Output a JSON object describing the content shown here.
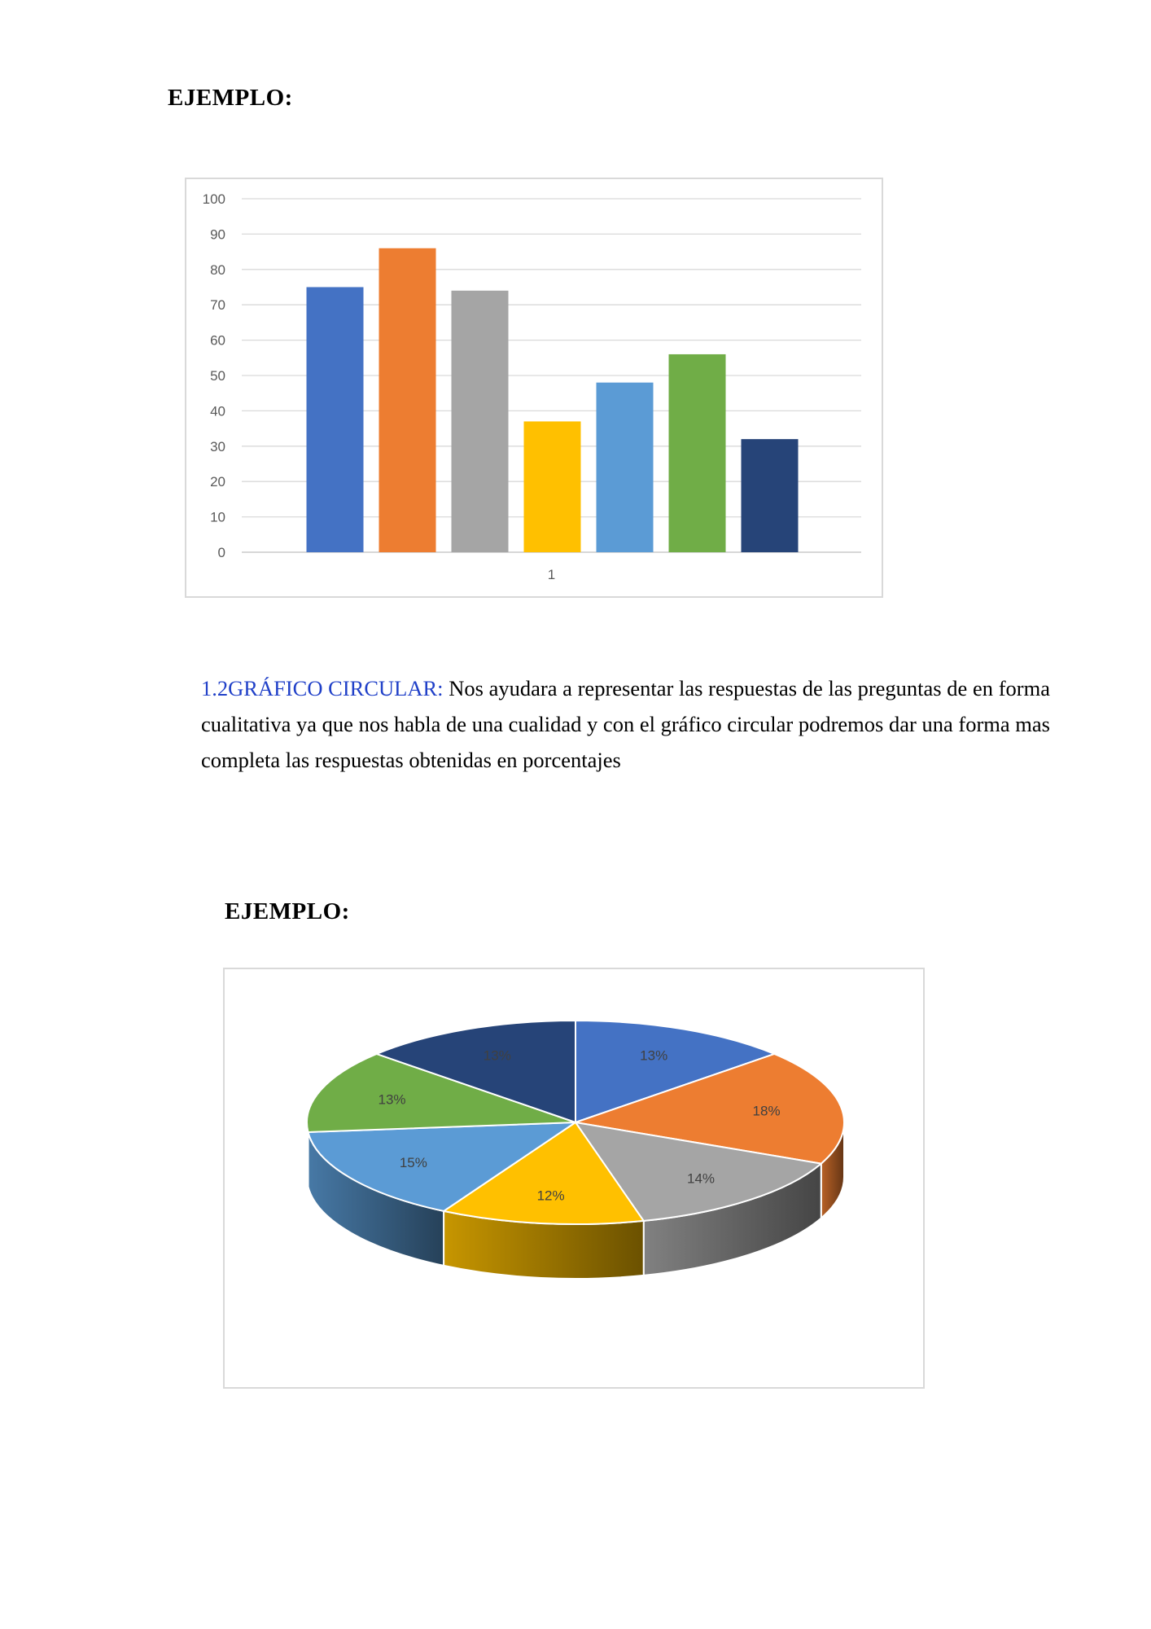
{
  "headings": {
    "first": "EJEMPLO:",
    "second": "EJEMPLO:"
  },
  "section": {
    "lead": "1.2GRÁFICO CIRCULAR:",
    "body": " Nos ayudara a representar  las respuestas  de las preguntas de  en forma cualitativa ya que nos habla de una cualidad y con el gráfico circular podremos dar una forma mas completa las respuestas obtenidas en porcentajes"
  },
  "chart_data": [
    {
      "type": "bar",
      "categories": [
        "1"
      ],
      "series": [
        {
          "values": [
            75
          ],
          "color": "#4472C4"
        },
        {
          "values": [
            86
          ],
          "color": "#ED7D31"
        },
        {
          "values": [
            74
          ],
          "color": "#A5A5A5"
        },
        {
          "values": [
            37
          ],
          "color": "#FFC000"
        },
        {
          "values": [
            48
          ],
          "color": "#5B9BD5"
        },
        {
          "values": [
            56
          ],
          "color": "#70AD47"
        },
        {
          "values": [
            32
          ],
          "color": "#264478"
        }
      ],
      "ylim": [
        0,
        100
      ],
      "yticks": [
        0,
        10,
        20,
        30,
        40,
        50,
        60,
        70,
        80,
        90,
        100
      ],
      "grid": true,
      "title": "",
      "xlabel": "",
      "ylabel": ""
    },
    {
      "type": "pie",
      "style": "3d",
      "slices": [
        {
          "label": "13%",
          "value": 13,
          "color": "#4472C4"
        },
        {
          "label": "18%",
          "value": 18,
          "color": "#ED7D31"
        },
        {
          "label": "14%",
          "value": 14,
          "color": "#A5A5A5"
        },
        {
          "label": "12%",
          "value": 12,
          "color": "#FFC000"
        },
        {
          "label": "15%",
          "value": 15,
          "color": "#5B9BD5"
        },
        {
          "label": "13%",
          "value": 13,
          "color": "#70AD47"
        },
        {
          "label": "13%",
          "value": 13,
          "color": "#264478"
        }
      ],
      "title": ""
    }
  ]
}
